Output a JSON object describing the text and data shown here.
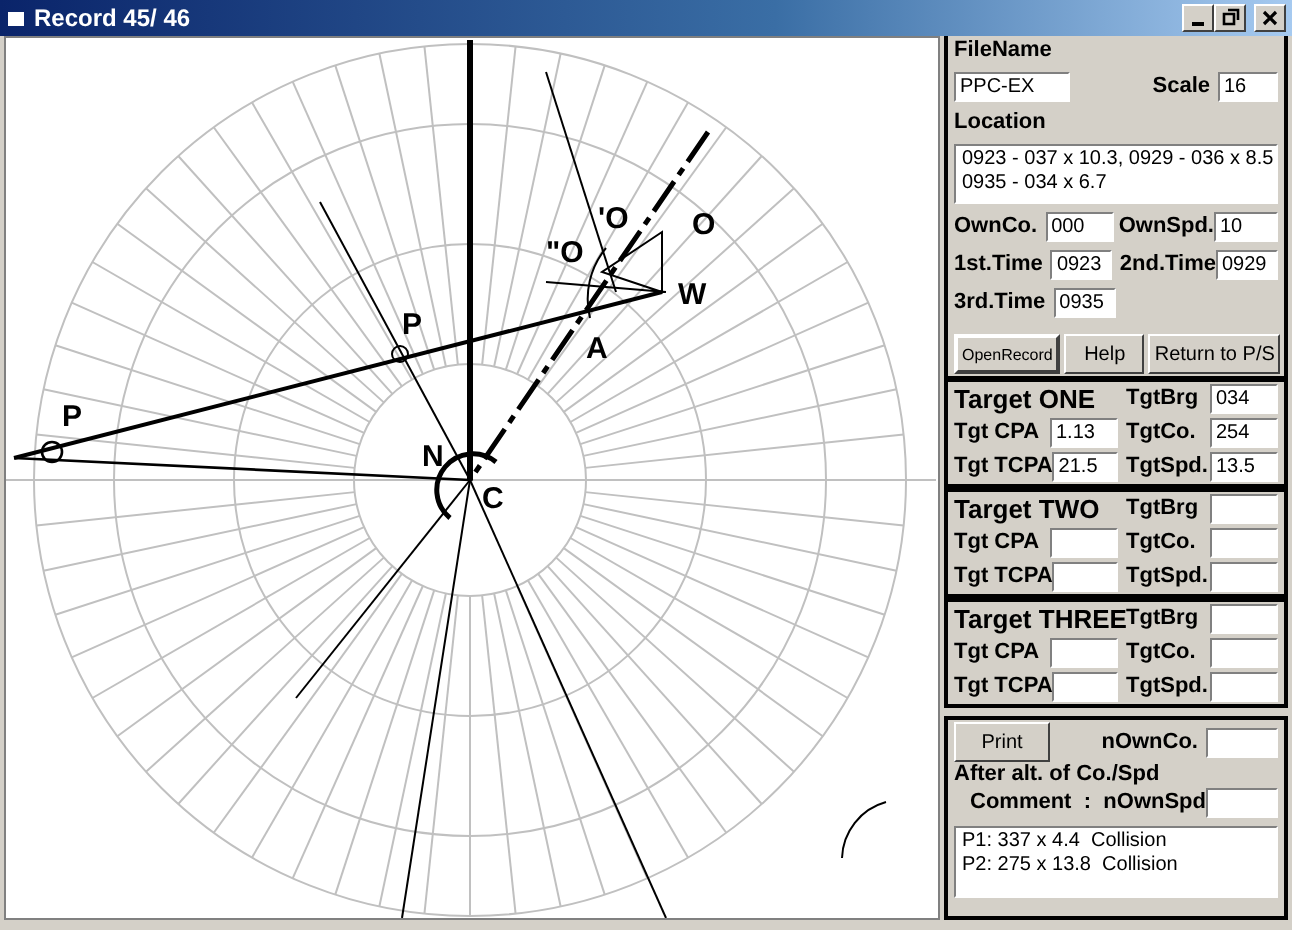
{
  "window": {
    "title": "Record 45/ 46"
  },
  "plot": {
    "labels": [
      {
        "text": "P"
      },
      {
        "text": "P"
      },
      {
        "text": "N"
      },
      {
        "text": "C"
      },
      {
        "text": "A"
      },
      {
        "text": "W"
      },
      {
        "text": "O"
      },
      {
        "text": "'O"
      },
      {
        "text": "\"O"
      }
    ]
  },
  "record": {
    "filename_label": "FileName",
    "filename": "PPC-EX",
    "scale_label": "Scale",
    "scale": "16",
    "location_label": "Location",
    "location_lines": [
      "0923 - 037 x 10.3, 0929 - 036 x 8.5",
      "0935 - 034 x 6.7"
    ],
    "ownco_label": "OwnCo.",
    "ownco": "000",
    "ownspd_label": "OwnSpd.",
    "ownspd": "10",
    "time1_label": "1st.Time",
    "time1": "0923",
    "time2_label": "2nd.Time",
    "time2": "0929",
    "time3_label": "3rd.Time",
    "time3": "0935"
  },
  "buttons": [
    {
      "label": "OpenRecord"
    },
    {
      "label": "Help"
    },
    {
      "label": "Return to P/S"
    }
  ],
  "targets": [
    {
      "title": "Target ONE",
      "cpa_label": "Tgt CPA",
      "cpa": "1.13",
      "tcpa_label": "Tgt TCPA",
      "tcpa": "21.5",
      "brg_label": "TgtBrg",
      "brg": "034",
      "co_label": "TgtCo.",
      "co": "254",
      "spd_label": "TgtSpd.",
      "spd": "13.5"
    },
    {
      "title": "Target TWO",
      "cpa_label": "Tgt CPA",
      "tcpa_label": "Tgt TCPA",
      "brg_label": "TgtBrg",
      "co_label": "TgtCo.",
      "spd_label": "TgtSpd."
    },
    {
      "title": "Target THREE",
      "cpa_label": "Tgt CPA",
      "tcpa_label": "Tgt TCPA",
      "brg_label": "TgtBrg",
      "co_label": "TgtCo.",
      "spd_label": "TgtSpd."
    }
  ],
  "after": {
    "print": "Print",
    "nownco_label": "nOwnCo.",
    "after_label": "After alt. of Co./Spd",
    "nownspd_label": "nOwnSpd",
    "comment_label": "Comment  :",
    "comment_lines": [
      "P1: 337 x 4.4  Collision",
      "P2: 275 x 13.8  Collision"
    ]
  }
}
